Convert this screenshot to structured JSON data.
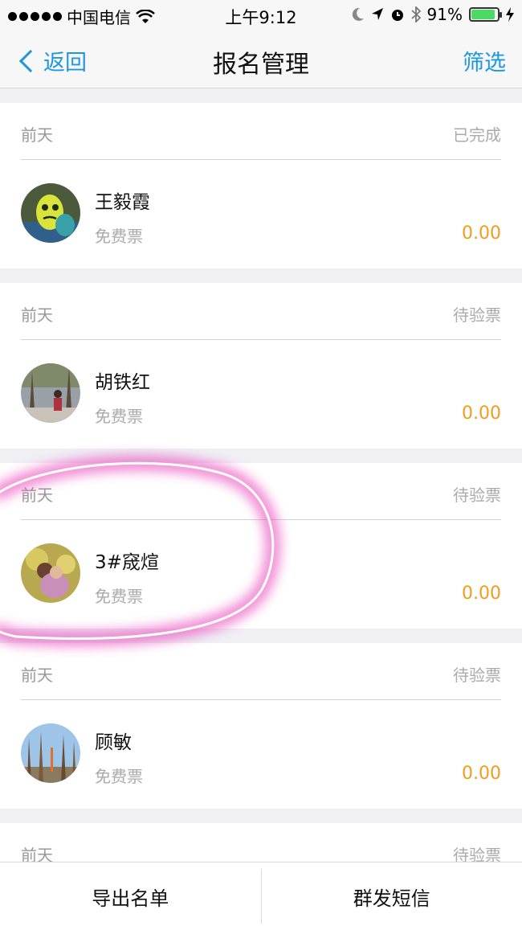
{
  "status_bar": {
    "carrier": "中国电信",
    "time": "上午9:12",
    "battery": "91%",
    "battery_level": 0.91
  },
  "nav": {
    "back_label": "返回",
    "title": "报名管理",
    "filter_label": "筛选"
  },
  "registrations": [
    {
      "date": "前天",
      "status": "已完成",
      "name": "王毅霞",
      "ticket": "免费票",
      "amount": "0.00",
      "avatar": "green-plush-toy"
    },
    {
      "date": "前天",
      "status": "待验票",
      "name": "胡铁红",
      "ticket": "免费票",
      "amount": "0.00",
      "avatar": "woman-in-forest"
    },
    {
      "date": "前天",
      "status": "待验票",
      "name": "3#窚煊",
      "ticket": "免费票",
      "amount": "0.00",
      "avatar": "two-people-yellow-flowers"
    },
    {
      "date": "前天",
      "status": "待验票",
      "name": "顾敏",
      "ticket": "免费票",
      "amount": "0.00",
      "avatar": "tall-trees-sky"
    },
    {
      "date": "前天",
      "status": "待验票"
    }
  ],
  "bottom": {
    "export_label": "导出名单",
    "sms_label": "群发短信"
  },
  "colors": {
    "accent": "#1e97e0",
    "amount": "#f39c1f",
    "highlight": "#e633b3"
  }
}
